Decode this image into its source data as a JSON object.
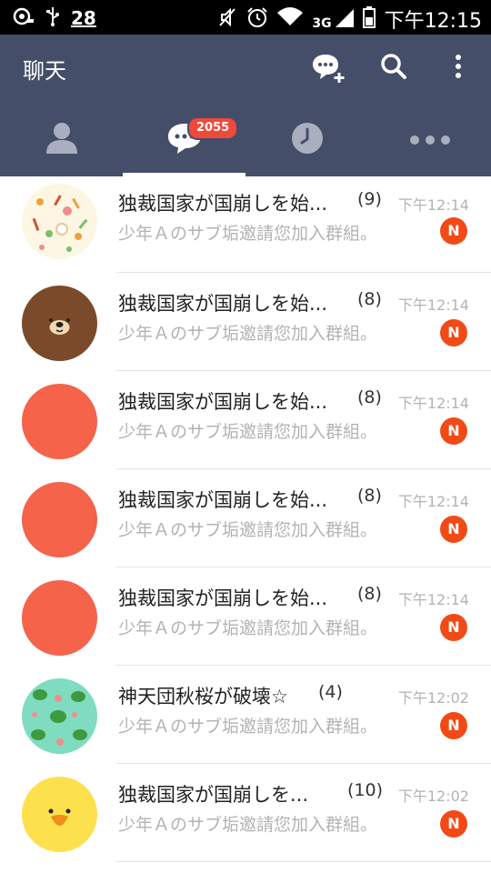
{
  "status_bar": {
    "notification_count": "28",
    "network": "3G",
    "time": "下午12:15"
  },
  "header": {
    "title": "聊天",
    "icons": [
      "new-chat-icon",
      "search-icon",
      "more-vert-icon"
    ]
  },
  "tabs": [
    {
      "name": "friends",
      "icon": "person-icon"
    },
    {
      "name": "chats",
      "icon": "chat-bubble-icon",
      "badge": "2055",
      "active": true
    },
    {
      "name": "timeline",
      "icon": "clock-icon"
    },
    {
      "name": "more",
      "icon": "more-horiz-icon"
    }
  ],
  "chats": [
    {
      "name": "独裁国家が国崩しを始...",
      "count": "(9)",
      "time": "下午12:14",
      "preview": "少年Ａのサブ垢邀請您加入群組。",
      "badge": "N",
      "avatar": "pattern-cream"
    },
    {
      "name": "独裁国家が国崩しを始...",
      "count": "(8)",
      "time": "下午12:14",
      "preview": "少年Ａのサブ垢邀請您加入群組。",
      "badge": "N",
      "avatar": "bear-brown"
    },
    {
      "name": "独裁国家が国崩しを始...",
      "count": "(8)",
      "time": "下午12:14",
      "preview": "少年Ａのサブ垢邀請您加入群組。",
      "badge": "N",
      "avatar": "pattern-red"
    },
    {
      "name": "独裁国家が国崩しを始...",
      "count": "(8)",
      "time": "下午12:14",
      "preview": "少年Ａのサブ垢邀請您加入群組。",
      "badge": "N",
      "avatar": "pattern-red"
    },
    {
      "name": "独裁国家が国崩しを始...",
      "count": "(8)",
      "time": "下午12:14",
      "preview": "少年Ａのサブ垢邀請您加入群組。",
      "badge": "N",
      "avatar": "pattern-red"
    },
    {
      "name": "神天団秋桜が破壊☆",
      "count": "(4)",
      "time": "下午12:02",
      "preview": "少年Ａのサブ垢邀請您加入群組。",
      "badge": "N",
      "avatar": "frog-pattern"
    },
    {
      "name": "独裁国家が国崩しを...",
      "count": "(10)",
      "time": "下午12:02",
      "preview": "少年Ａのサブ垢邀請您加入群組。",
      "badge": "N",
      "avatar": "chick-yellow"
    }
  ],
  "colors": {
    "header_bg": "#454e68",
    "badge_red": "#f0483a",
    "n_badge": "#f24a17",
    "muted_text": "#b3b3b3"
  }
}
